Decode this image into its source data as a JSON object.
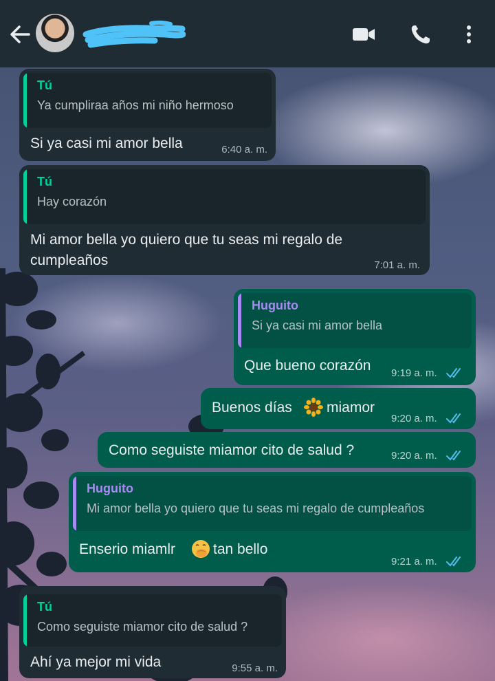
{
  "header": {
    "contact_name": "",
    "icons": [
      "back-arrow-icon",
      "video-call-icon",
      "voice-call-icon",
      "more-vert-icon"
    ]
  },
  "colors": {
    "header_bg": "#1f2c33",
    "incoming_bubble": "#1f2c33",
    "outgoing_bubble": "#005c4b",
    "quote_incoming_accent": "#06cf9c",
    "quote_outgoing_accent": "#a78bf3",
    "read_ticks": "#53bdeb",
    "contact_name_scribble": "#4fc3f7"
  },
  "messages": [
    {
      "direction": "in",
      "quote": {
        "author": "Tú",
        "text": "Ya cumpliraa años mi niño hermoso"
      },
      "text": "Si ya casi mi amor bella",
      "time": "6:40 a. m."
    },
    {
      "direction": "in",
      "quote": {
        "author": "Tú",
        "text": "Hay corazón"
      },
      "text": "Mi amor bella yo quiero que tu seas mi regalo de cumpleaños",
      "time": "7:01 a. m."
    },
    {
      "direction": "out",
      "quote": {
        "author": "Huguito",
        "text": "Si ya casi mi amor bella"
      },
      "text": "Que bueno corazón",
      "time": "9:19 a. m.",
      "status": "read"
    },
    {
      "direction": "out",
      "text_before": "Buenos días",
      "emoji": "sunflower",
      "text_after": "miamor",
      "time": "9:20 a. m.",
      "status": "read"
    },
    {
      "direction": "out",
      "text": "Como seguiste miamor cito de salud ?",
      "time": "9:20 a. m.",
      "status": "read"
    },
    {
      "direction": "out",
      "quote": {
        "author": "Huguito",
        "text": "Mi amor bella yo quiero que tu seas mi regalo de cumpleaños"
      },
      "text_before": "Enserio miamlr",
      "emoji": "face-with-hand-over-mouth",
      "text_after": "tan bello",
      "time": "9:21 a. m.",
      "status": "read"
    },
    {
      "direction": "in",
      "quote": {
        "author": "Tú",
        "text": "Como seguiste miamor cito de salud ?"
      },
      "text": "Ahí ya mejor mi vida",
      "time": "9:55 a. m."
    }
  ]
}
